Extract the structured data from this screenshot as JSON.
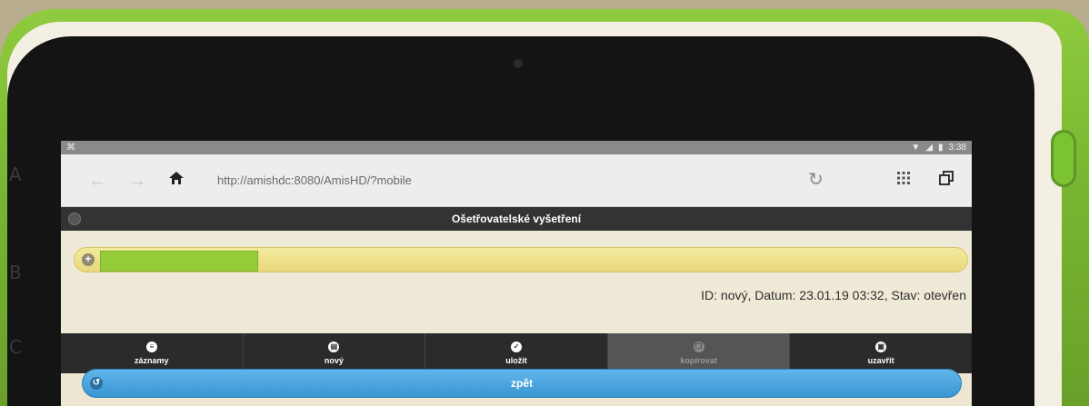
{
  "device": {
    "side_letters": [
      "A",
      "B",
      "C"
    ]
  },
  "statusbar": {
    "left_icon": "notification-icon",
    "time": "3:38",
    "icons": [
      "wifi-icon",
      "signal-icon",
      "battery-icon"
    ]
  },
  "browser": {
    "url": "http://amishdc:8080/AmisHD/?mobile",
    "icons": [
      "back-arrow-icon",
      "forward-arrow-icon",
      "home-icon",
      "reload-icon",
      "apps-grid-icon",
      "tabs-icon"
    ]
  },
  "page": {
    "title": "Ošetřovatelské vyšetření",
    "info": "ID: nový, Datum: 23.01.19 03:32, Stav: otevřen"
  },
  "toolbar": [
    {
      "label": "záznamy",
      "icon": "menu-icon",
      "enabled": true
    },
    {
      "label": "nový",
      "icon": "document-icon",
      "enabled": true
    },
    {
      "label": "uložit",
      "icon": "check-icon",
      "enabled": true
    },
    {
      "label": "kopírovat",
      "icon": "copy-icon",
      "enabled": false
    },
    {
      "label": "uzavřít",
      "icon": "lock-icon",
      "enabled": true
    }
  ],
  "back_button": {
    "label": "zpět"
  },
  "colors": {
    "accent_blue": "#3a95d3",
    "collapsible_yellow": "#f4ea9e",
    "toolbar_dark": "#2b2b2b",
    "title_dark": "#333333"
  }
}
